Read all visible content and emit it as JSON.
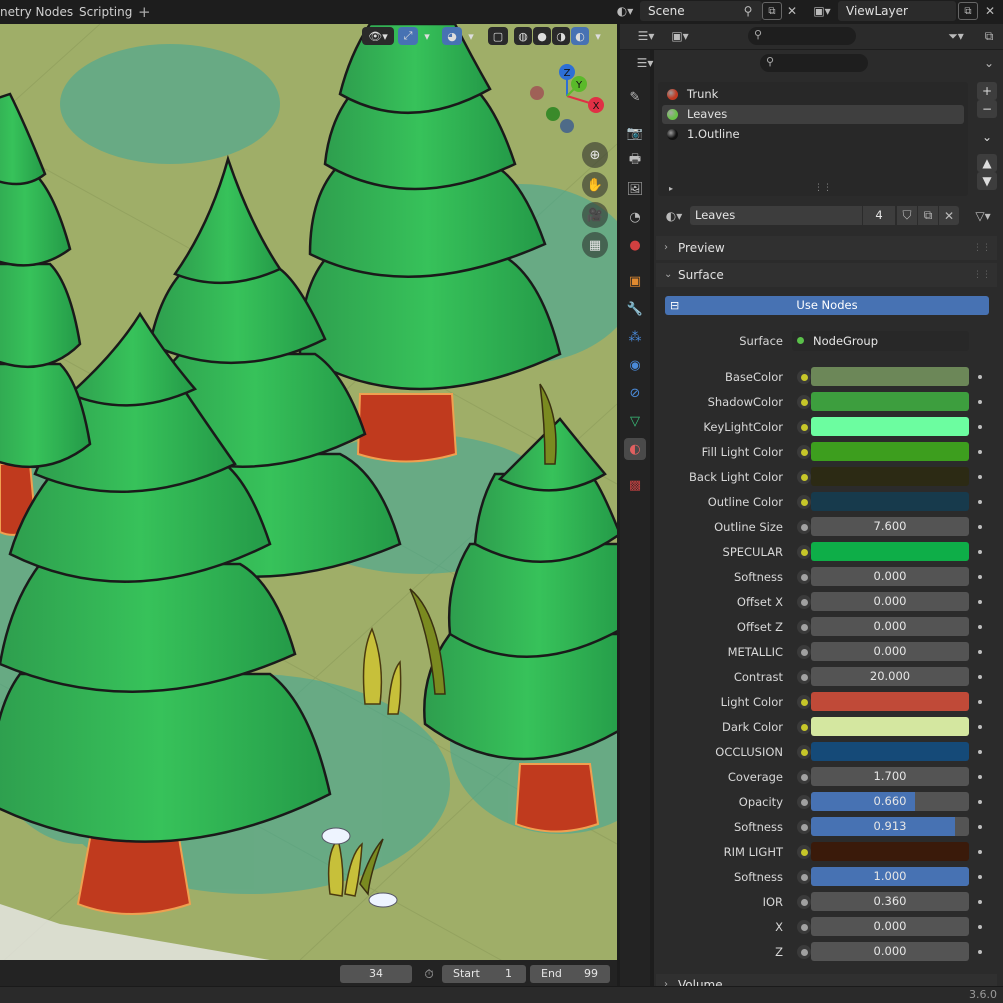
{
  "workspace_tabs": [
    "netry Nodes",
    "Scripting"
  ],
  "add_tab_symbol": "+",
  "scene": {
    "label": "Scene"
  },
  "view_layer": {
    "label": "ViewLayer"
  },
  "viewport": {
    "axes": {
      "x": "X",
      "y": "Y",
      "z": "Z"
    }
  },
  "timeline": {
    "current_frame": "34",
    "start_label": "Start",
    "start_value": "1",
    "end_label": "End",
    "end_value": "99"
  },
  "status": {
    "version": "3.6.0"
  },
  "material_slots": [
    {
      "name": "Trunk",
      "color": "#c03a22"
    },
    {
      "name": "Leaves",
      "color": "#6ac24a"
    },
    {
      "name": "1.Outline",
      "color": "#111111"
    }
  ],
  "material": {
    "name": "Leaves",
    "users": "4"
  },
  "panels": {
    "preview": "Preview",
    "surface": "Surface",
    "use_nodes": "Use Nodes",
    "volume": "Volume"
  },
  "surface": {
    "label": "Surface",
    "value": "NodeGroup"
  },
  "properties": [
    {
      "label": "BaseColor",
      "type": "color",
      "color": "#6c8758",
      "socket": "#c7c729"
    },
    {
      "label": "ShadowColor",
      "type": "color",
      "color": "#3d9e3e",
      "socket": "#c7c729"
    },
    {
      "label": "KeyLightColor",
      "type": "color",
      "color": "#6cfda0",
      "socket": "#c7c729"
    },
    {
      "label": "Fill Light Color",
      "type": "color",
      "color": "#3d9e1e",
      "socket": "#c7c729"
    },
    {
      "label": "Back Light Color",
      "type": "color",
      "color": "#2c2a14",
      "socket": "#c7c729"
    },
    {
      "label": "Outline Color",
      "type": "color",
      "color": "#173a4c",
      "socket": "#c7c729"
    },
    {
      "label": "Outline Size",
      "type": "value",
      "value": "7.600",
      "socket": "#a1a1a1"
    },
    {
      "label": "SPECULAR",
      "type": "color",
      "color": "#0eae48",
      "socket": "#c7c729"
    },
    {
      "label": "Softness",
      "type": "value",
      "value": "0.000",
      "socket": "#a1a1a1"
    },
    {
      "label": "Offset X",
      "type": "value",
      "value": "0.000",
      "socket": "#a1a1a1"
    },
    {
      "label": "Offset Z",
      "type": "value",
      "value": "0.000",
      "socket": "#a1a1a1"
    },
    {
      "label": "METALLIC",
      "type": "value",
      "value": "0.000",
      "socket": "#a1a1a1"
    },
    {
      "label": "Contrast",
      "type": "value",
      "value": "20.000",
      "socket": "#a1a1a1"
    },
    {
      "label": "Light Color",
      "type": "color",
      "color": "#c04a38",
      "socket": "#c7c729"
    },
    {
      "label": "Dark Color",
      "type": "color",
      "color": "#d4e7a0",
      "socket": "#c7c729"
    },
    {
      "label": "OCCLUSION",
      "type": "color",
      "color": "#154a78",
      "socket": "#c7c729"
    },
    {
      "label": "Coverage",
      "type": "value",
      "value": "1.700",
      "socket": "#a1a1a1"
    },
    {
      "label": "Opacity",
      "type": "slider",
      "value": "0.660",
      "fraction": 0.66,
      "socket": "#a1a1a1"
    },
    {
      "label": "Softness",
      "type": "slider",
      "value": "0.913",
      "fraction": 0.913,
      "socket": "#a1a1a1"
    },
    {
      "label": "RIM LIGHT",
      "type": "color",
      "color": "#3a1a0a",
      "socket": "#c7c729"
    },
    {
      "label": "Softness",
      "type": "slider",
      "value": "1.000",
      "fraction": 1.0,
      "socket": "#a1a1a1"
    },
    {
      "label": "IOR",
      "type": "value",
      "value": "0.360",
      "socket": "#a1a1a1"
    },
    {
      "label": "X",
      "type": "value",
      "value": "0.000",
      "socket": "#a1a1a1"
    },
    {
      "label": "Z",
      "type": "value",
      "value": "0.000",
      "socket": "#a1a1a1"
    }
  ]
}
